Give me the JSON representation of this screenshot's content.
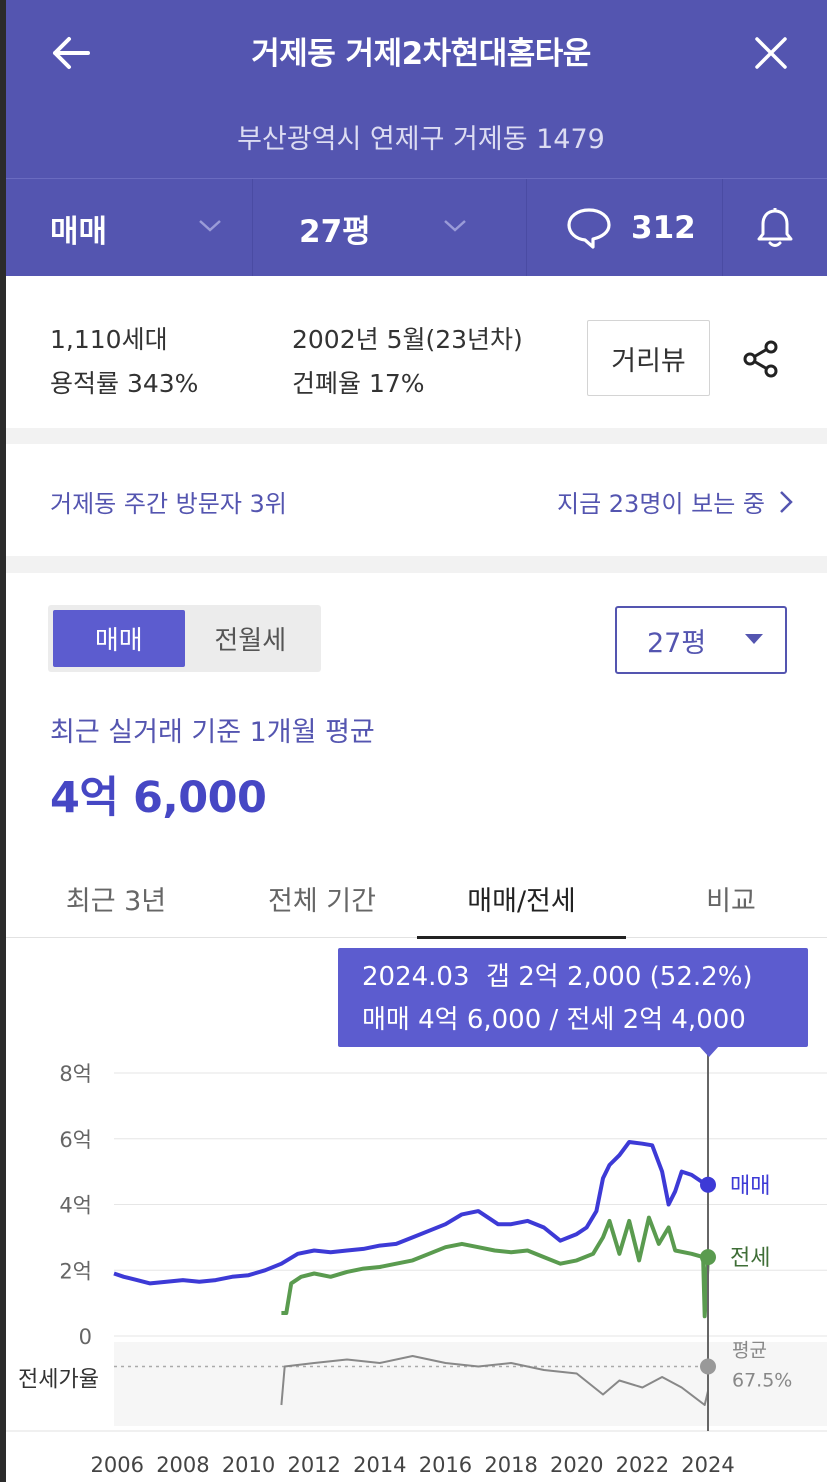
{
  "header": {
    "title": "거제동 거제2차현대홈타운",
    "address": "부산광역시 연제구 거제동 1479",
    "trade_type": "매매",
    "pyeong": "27평",
    "comment_count": "312"
  },
  "info": {
    "households": "1,110세대",
    "floor_area_ratio": "용적률 343%",
    "built": "2002년 5월(23년차)",
    "coverage_ratio": "건폐율 17%",
    "street_view_label": "거리뷰"
  },
  "visitor": {
    "rank_text": "거제동 주간 방문자 3위",
    "watching_text": "지금 23명이 보는 중"
  },
  "price": {
    "segment": [
      "매매",
      "전월세"
    ],
    "size_selected": "27평",
    "avg_label": "최근 실거래 기준 1개월 평균",
    "avg_value": "4억 6,000",
    "tabs": [
      "최근 3년",
      "전체 기간",
      "매매/전세",
      "비교"
    ],
    "active_tab": 2
  },
  "tooltip": {
    "line1": "2024.03  갭 2억 2,000 (52.2%)",
    "line2": "매매 4억 6,000 / 전세 2억 4,000"
  },
  "colors": {
    "header_bg": "#5455b0",
    "accent": "#5c5ccf",
    "sale_line": "#3d3ad6",
    "jeonse_line": "#5a9b4f",
    "ratio_line": "#888888"
  },
  "chart_data": {
    "type": "line",
    "yticks": [
      "8억",
      "6억",
      "4억",
      "2억",
      "0"
    ],
    "ylim": [
      0,
      8
    ],
    "xticks": [
      "2006",
      "2008",
      "2010",
      "2012",
      "2014",
      "2016",
      "2018",
      "2020",
      "2022",
      "2024"
    ],
    "xlim": [
      2005.9,
      2024.0
    ],
    "series": [
      {
        "name": "매매",
        "points": [
          [
            2005.9,
            1.9
          ],
          [
            2006.2,
            1.8
          ],
          [
            2006.6,
            1.7
          ],
          [
            2007.0,
            1.6
          ],
          [
            2007.5,
            1.65
          ],
          [
            2008.0,
            1.7
          ],
          [
            2008.5,
            1.65
          ],
          [
            2009.0,
            1.7
          ],
          [
            2009.5,
            1.8
          ],
          [
            2010.0,
            1.85
          ],
          [
            2010.5,
            2.0
          ],
          [
            2011.0,
            2.2
          ],
          [
            2011.5,
            2.5
          ],
          [
            2012.0,
            2.6
          ],
          [
            2012.5,
            2.55
          ],
          [
            2013.0,
            2.6
          ],
          [
            2013.5,
            2.65
          ],
          [
            2014.0,
            2.75
          ],
          [
            2014.5,
            2.8
          ],
          [
            2015.0,
            3.0
          ],
          [
            2015.5,
            3.2
          ],
          [
            2016.0,
            3.4
          ],
          [
            2016.5,
            3.7
          ],
          [
            2017.0,
            3.8
          ],
          [
            2017.3,
            3.6
          ],
          [
            2017.6,
            3.4
          ],
          [
            2018.0,
            3.4
          ],
          [
            2018.5,
            3.5
          ],
          [
            2019.0,
            3.3
          ],
          [
            2019.5,
            2.9
          ],
          [
            2020.0,
            3.1
          ],
          [
            2020.3,
            3.3
          ],
          [
            2020.6,
            3.8
          ],
          [
            2020.8,
            4.8
          ],
          [
            2021.0,
            5.2
          ],
          [
            2021.3,
            5.5
          ],
          [
            2021.6,
            5.9
          ],
          [
            2022.0,
            5.85
          ],
          [
            2022.3,
            5.8
          ],
          [
            2022.6,
            5.0
          ],
          [
            2022.8,
            4.0
          ],
          [
            2023.0,
            4.4
          ],
          [
            2023.2,
            5.0
          ],
          [
            2023.5,
            4.9
          ],
          [
            2023.8,
            4.7
          ],
          [
            2024.0,
            4.6
          ]
        ]
      },
      {
        "name": "전세",
        "points": [
          [
            2011.0,
            0.7
          ],
          [
            2011.15,
            0.7
          ],
          [
            2011.3,
            1.6
          ],
          [
            2011.6,
            1.8
          ],
          [
            2012.0,
            1.9
          ],
          [
            2012.5,
            1.8
          ],
          [
            2013.0,
            1.95
          ],
          [
            2013.5,
            2.05
          ],
          [
            2014.0,
            2.1
          ],
          [
            2014.5,
            2.2
          ],
          [
            2015.0,
            2.3
          ],
          [
            2015.5,
            2.5
          ],
          [
            2016.0,
            2.7
          ],
          [
            2016.5,
            2.8
          ],
          [
            2017.0,
            2.7
          ],
          [
            2017.5,
            2.6
          ],
          [
            2018.0,
            2.55
          ],
          [
            2018.5,
            2.6
          ],
          [
            2019.0,
            2.4
          ],
          [
            2019.5,
            2.2
          ],
          [
            2020.0,
            2.3
          ],
          [
            2020.5,
            2.5
          ],
          [
            2020.8,
            3.0
          ],
          [
            2021.0,
            3.5
          ],
          [
            2021.3,
            2.5
          ],
          [
            2021.6,
            3.5
          ],
          [
            2021.9,
            2.3
          ],
          [
            2022.2,
            3.6
          ],
          [
            2022.5,
            2.8
          ],
          [
            2022.8,
            3.3
          ],
          [
            2023.0,
            2.6
          ],
          [
            2023.5,
            2.5
          ],
          [
            2023.85,
            2.4
          ],
          [
            2023.9,
            0.6
          ],
          [
            2024.0,
            2.4
          ]
        ]
      },
      {
        "name": "전세가율",
        "points": [
          [
            2011.0,
            0.3
          ],
          [
            2011.1,
            0.85
          ],
          [
            2012.0,
            0.9
          ],
          [
            2013.0,
            0.95
          ],
          [
            2014.0,
            0.9
          ],
          [
            2015.0,
            1.0
          ],
          [
            2016.0,
            0.9
          ],
          [
            2017.0,
            0.85
          ],
          [
            2018.0,
            0.9
          ],
          [
            2019.0,
            0.8
          ],
          [
            2020.0,
            0.75
          ],
          [
            2020.8,
            0.45
          ],
          [
            2021.3,
            0.65
          ],
          [
            2022.0,
            0.55
          ],
          [
            2022.6,
            0.7
          ],
          [
            2023.2,
            0.55
          ],
          [
            2023.9,
            0.3
          ],
          [
            2024.0,
            0.5
          ]
        ]
      }
    ],
    "legend": {
      "sale": "매매",
      "jeonse": "전세",
      "ratio": "전세가율",
      "ratio_avg_label": "평균",
      "ratio_avg_value": "67.5%"
    }
  }
}
